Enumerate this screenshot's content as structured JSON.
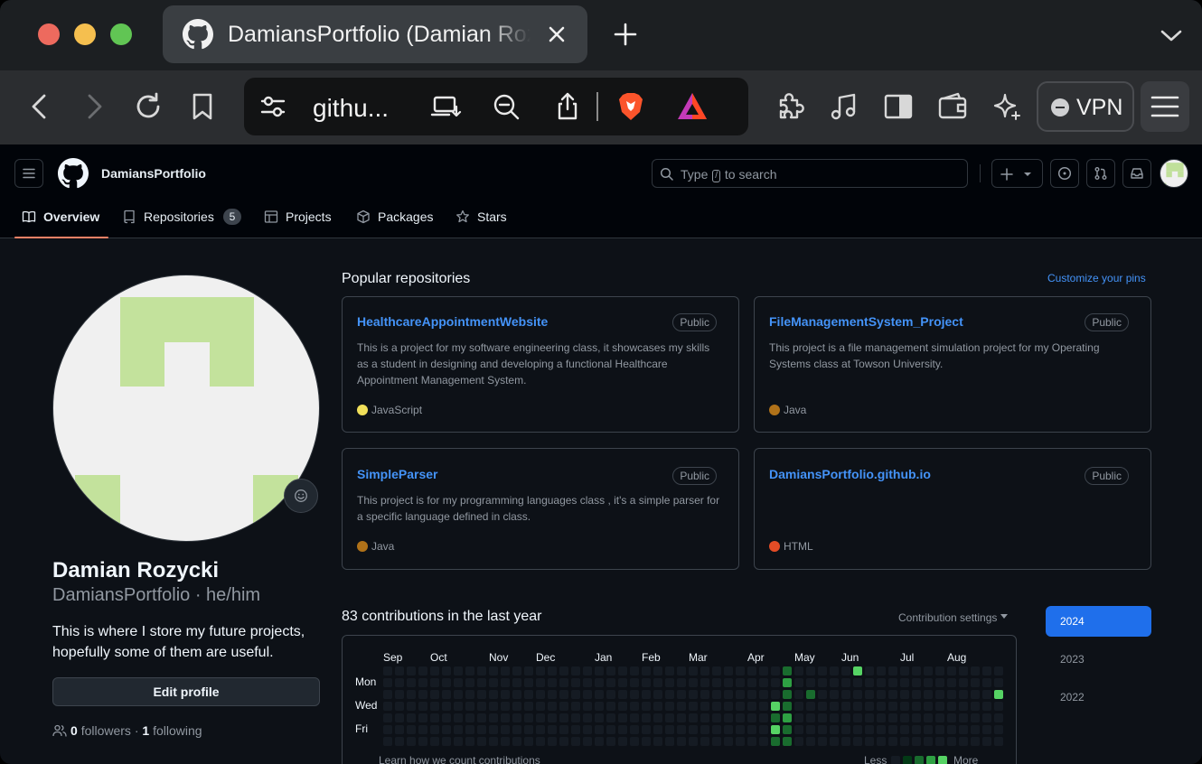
{
  "browser": {
    "tab_title": "DamiansPortfolio (Damian Rozycki)",
    "url_display": "githu...",
    "vpn_label": "VPN",
    "icons": [
      "back-icon",
      "forward-icon",
      "reload-icon",
      "bookmark-icon",
      "site-settings-icon",
      "install-app-icon",
      "zoom-out-icon",
      "share-icon",
      "brave-shields-icon",
      "brave-rewards-icon",
      "extensions-icon",
      "media-icon",
      "sidebar-icon",
      "wallet-icon",
      "leo-ai-icon",
      "menu-icon"
    ]
  },
  "header": {
    "context": "DamiansPortfolio",
    "search_prefix": "Type",
    "search_key": "/",
    "search_suffix": "to search"
  },
  "nav": {
    "tabs": [
      {
        "label": "Overview",
        "icon": "book-icon",
        "active": true
      },
      {
        "label": "Repositories",
        "icon": "repo-icon",
        "count": "5"
      },
      {
        "label": "Projects",
        "icon": "table-icon"
      },
      {
        "label": "Packages",
        "icon": "package-icon"
      },
      {
        "label": "Stars",
        "icon": "star-icon"
      }
    ]
  },
  "profile": {
    "name": "Damian Rozycki",
    "login_line": "DamiansPortfolio · he/him",
    "bio": "This is where I store my future projects, hopefully some of them are useful.",
    "edit_label": "Edit profile",
    "followers_count": "0",
    "followers_label": "followers",
    "separator": " · ",
    "following_count": "1",
    "following_label": "following"
  },
  "pinned": {
    "title": "Popular repositories",
    "customize": "Customize your pins",
    "repos": [
      {
        "name": "HealthcareAppointmentWebsite",
        "visibility": "Public",
        "description": "This is a project for my software engineering class, it showcases my skills as a student in designing and developing a functional Healthcare Appointment Management System.",
        "language": "JavaScript",
        "lang_color": "#f1e05a"
      },
      {
        "name": "FileManagementSystem_Project",
        "visibility": "Public",
        "description": "This project is a file management simulation project for my Operating Systems class at Towson University.",
        "language": "Java",
        "lang_color": "#b07219"
      },
      {
        "name": "SimpleParser",
        "visibility": "Public",
        "description": "This project is for my programming languages class , it's a simple parser for a specific language defined in class.",
        "language": "Java",
        "lang_color": "#b07219"
      },
      {
        "name": "DamiansPortfolio.github.io",
        "visibility": "Public",
        "description": "",
        "language": "HTML",
        "lang_color": "#e34c26"
      }
    ]
  },
  "contributions": {
    "title": "83 contributions in the last year",
    "settings": "Contribution settings",
    "months": [
      "Sep",
      "Oct",
      "Nov",
      "Dec",
      "Jan",
      "Feb",
      "Mar",
      "Apr",
      "May",
      "Jun",
      "Jul",
      "Aug"
    ],
    "days": [
      "Mon",
      "Wed",
      "Fri"
    ],
    "footer_left": "Learn how we count contributions",
    "less": "Less",
    "more": "More",
    "years": [
      "2024",
      "2023",
      "2022"
    ],
    "active_year": "2024",
    "colors": {
      "empty": "#151b23",
      "l1": "#033a16",
      "l2": "#196c2e",
      "l3": "#2ea043",
      "l4": "#56d364"
    },
    "active_cells": [
      {
        "week": 34,
        "day": 0,
        "level": 2
      },
      {
        "week": 34,
        "day": 1,
        "level": 3
      },
      {
        "week": 34,
        "day": 2,
        "level": 2
      },
      {
        "week": 34,
        "day": 3,
        "level": 2
      },
      {
        "week": 34,
        "day": 4,
        "level": 3
      },
      {
        "week": 34,
        "day": 5,
        "level": 2
      },
      {
        "week": 34,
        "day": 6,
        "level": 2
      },
      {
        "week": 33,
        "day": 3,
        "level": 4
      },
      {
        "week": 33,
        "day": 4,
        "level": 2
      },
      {
        "week": 33,
        "day": 5,
        "level": 4
      },
      {
        "week": 33,
        "day": 6,
        "level": 2
      },
      {
        "week": 36,
        "day": 2,
        "level": 2
      },
      {
        "week": 40,
        "day": 0,
        "level": 4
      },
      {
        "week": 52,
        "day": 2,
        "level": 4
      }
    ]
  }
}
